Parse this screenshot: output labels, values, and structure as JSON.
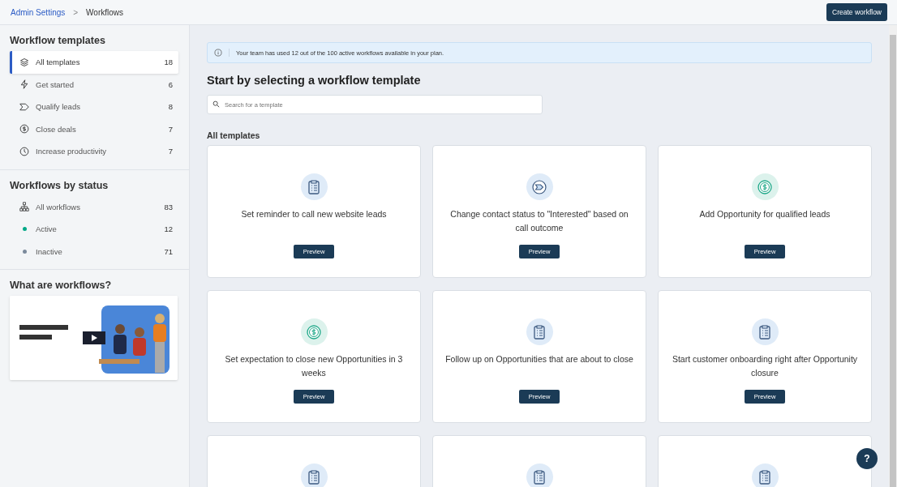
{
  "breadcrumb": {
    "parent": "Admin Settings",
    "separator": ">",
    "current": "Workflows"
  },
  "create_button": "Create workflow",
  "sidebar": {
    "templates_title": "Workflow templates",
    "template_items": [
      {
        "label": "All templates",
        "count": "18",
        "kind": "layers",
        "selected": true
      },
      {
        "label": "Get started",
        "count": "6",
        "kind": "bolt",
        "selected": false
      },
      {
        "label": "Qualify leads",
        "count": "8",
        "kind": "tag",
        "selected": false
      },
      {
        "label": "Close deals",
        "count": "7",
        "kind": "dollar",
        "selected": false
      },
      {
        "label": "Increase productivity",
        "count": "7",
        "kind": "clock",
        "selected": false
      }
    ],
    "status_title": "Workflows by status",
    "status_items": [
      {
        "label": "All workflows",
        "count": "83",
        "kind": "tree",
        "selected": false
      },
      {
        "label": "Active",
        "count": "12",
        "kind": "dot",
        "color": "#00a886",
        "selected": false
      },
      {
        "label": "Inactive",
        "count": "71",
        "kind": "dot",
        "color": "#7b8a9c",
        "selected": false
      }
    ],
    "video_title": "What are workflows?"
  },
  "banner": "Your team has used 12 out of the 100 active workflows available in your plan.",
  "heading": "Start by selecting a workflow template",
  "search": {
    "placeholder": "Search for a template"
  },
  "section_title": "All templates",
  "cards": [
    {
      "kind": "clipboard",
      "title": "Set reminder to call new website leads",
      "button": "Preview"
    },
    {
      "kind": "arrow",
      "title": "Change contact status to \"Interested\" based on call outcome",
      "button": "Preview"
    },
    {
      "kind": "dollar",
      "title": "Add Opportunity for qualified leads",
      "button": "Preview"
    },
    {
      "kind": "dollar",
      "title": "Set expectation to close new Opportunities in 3 weeks",
      "button": "Preview"
    },
    {
      "kind": "clipboard",
      "title": "Follow up on Opportunities that are about to close",
      "button": "Preview"
    },
    {
      "kind": "clipboard",
      "title": "Start customer onboarding right after Opportunity closure",
      "button": "Preview"
    },
    {
      "kind": "clipboard"
    },
    {
      "kind": "clipboard"
    },
    {
      "kind": "clipboard"
    }
  ],
  "help_button": "?"
}
